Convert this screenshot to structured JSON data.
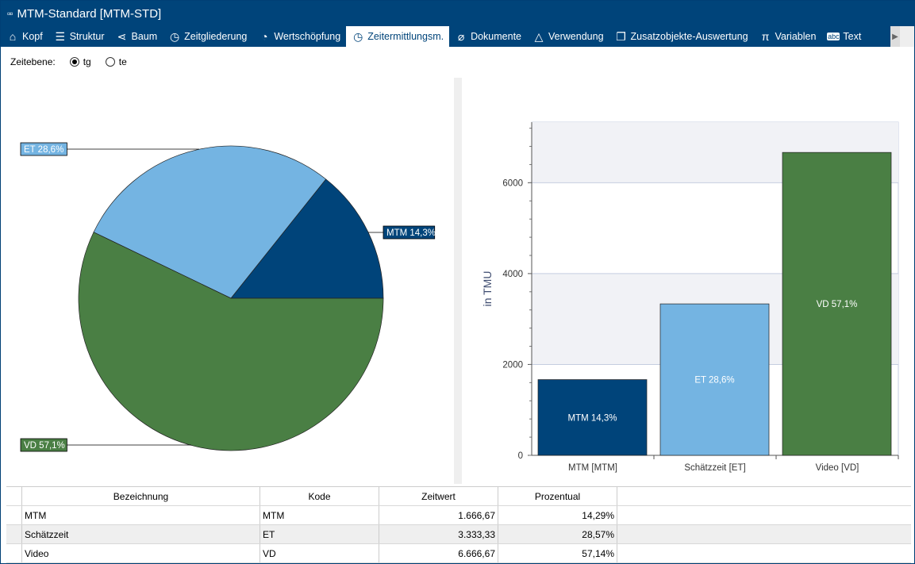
{
  "window": {
    "title": "MTM-Standard [MTM-STD]",
    "icon": "grid-icon"
  },
  "tabs": [
    {
      "label": "Kopf",
      "icon": "home-icon",
      "glyph": "⌂"
    },
    {
      "label": "Struktur",
      "icon": "list-icon",
      "glyph": "☰"
    },
    {
      "label": "Baum",
      "icon": "share-icon",
      "glyph": "⋖"
    },
    {
      "label": "Zeitgliederung",
      "icon": "clock-icon",
      "glyph": "◷"
    },
    {
      "label": "Wertschöpfung",
      "icon": "pie-icon",
      "glyph": "◔"
    },
    {
      "label": "Zeitermittlungsm.",
      "icon": "clock-refresh-icon",
      "glyph": "◷",
      "active": true
    },
    {
      "label": "Dokumente",
      "icon": "paperclip-icon",
      "glyph": "⌀"
    },
    {
      "label": "Verwendung",
      "icon": "recycle-icon",
      "glyph": "△"
    },
    {
      "label": "Zusatzobjekte-Auswertung",
      "icon": "box-icon",
      "glyph": "❐"
    },
    {
      "label": "Variablen",
      "icon": "pi-icon",
      "glyph": "π"
    },
    {
      "label": "Text",
      "icon": "abc-icon",
      "glyph": "abc"
    }
  ],
  "level": {
    "label": "Zeitebene:",
    "options": [
      {
        "label": "tg",
        "selected": true
      },
      {
        "label": "te",
        "selected": false
      }
    ]
  },
  "chart_data": [
    {
      "type": "pie",
      "slices": [
        {
          "label": "MTM 14,3%",
          "value": 14.29,
          "color": "#00447a"
        },
        {
          "label": "ET 28,6%",
          "value": 28.57,
          "color": "#74b4e2"
        },
        {
          "label": "VD 57,1%",
          "value": 57.14,
          "color": "#4a7f44"
        }
      ]
    },
    {
      "type": "bar",
      "categories": [
        "MTM [MTM]",
        "Schätzzeit [ET]",
        "Video [VD]"
      ],
      "values": [
        1666.67,
        3333.33,
        6666.67
      ],
      "labels": [
        "MTM 14,3%",
        "ET 28,6%",
        "VD 57,1%"
      ],
      "colors": [
        "#00447a",
        "#74b4e2",
        "#4a7f44"
      ],
      "ylabel": "in TMU",
      "ylim": [
        0,
        7333
      ],
      "yticks": [
        0,
        2000,
        4000,
        6000
      ],
      "grid": true
    }
  ],
  "table": {
    "columns": [
      "Bezeichnung",
      "Kode",
      "Zeitwert",
      "Prozentual"
    ],
    "rows": [
      [
        "MTM",
        "MTM",
        "1.666,67",
        "14,29%"
      ],
      [
        "Schätzzeit",
        "ET",
        "3.333,33",
        "28,57%"
      ],
      [
        "Video",
        "VD",
        "6.666,67",
        "57,14%"
      ]
    ]
  }
}
